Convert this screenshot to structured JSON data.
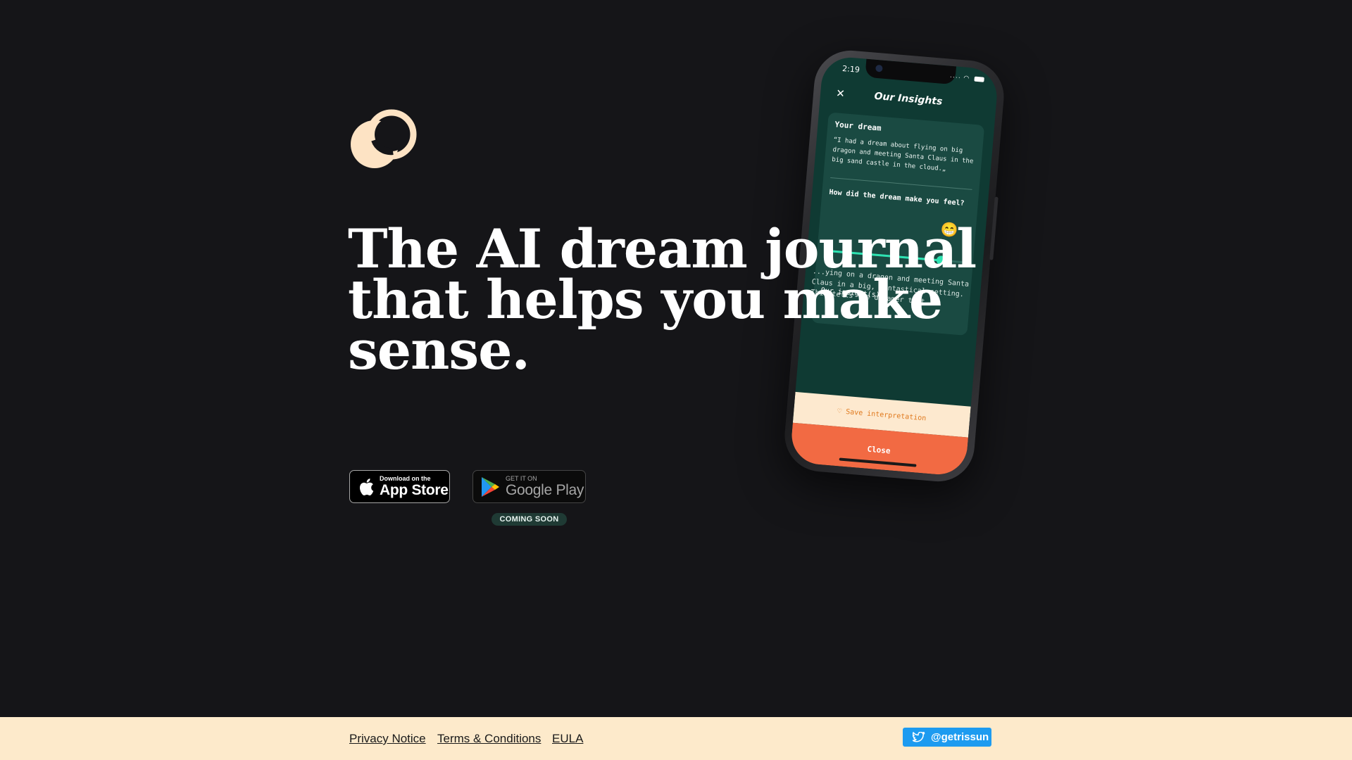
{
  "hero": {
    "headline": "The AI dream journal that helps you make sense."
  },
  "phone": {
    "status_time": "2:19",
    "close_symbol": "✕",
    "title": "Our Insights",
    "dream_label": "Your dream",
    "dream_text": "“I had a dream about flying on big dragon and meeting Santa Claus in the big sand castle in the cloud.„",
    "feel_question": "How did the dream make you feel?",
    "feel_emoji": "😁",
    "feel_level": 0.83,
    "insights_label": "Our insight(s)",
    "insight_text": "...ying on a dragon and meeting Santa Claus in a big, fantastical setting. This tells the dreamer that",
    "save_label": "Save interpretation",
    "close_label": "Close"
  },
  "badges": {
    "apple_small": "Download on the",
    "apple_big": "App Store",
    "google_small": "GET IT ON",
    "google_big": "Google Play",
    "coming_soon": "COMING SOON"
  },
  "footer": {
    "privacy": "Privacy Notice",
    "terms": "Terms & Conditions",
    "eula": "EULA",
    "twitter_handle": "@getrissun"
  },
  "colors": {
    "background": "#151518",
    "logo": "#fde3c4",
    "screen": "#0f3a33",
    "accent_green": "#2ee3b2",
    "save": "#fde9cf",
    "close": "#f26a43",
    "footer": "#fdeacb",
    "twitter": "#1d9bf0"
  },
  "icons": {
    "logo": "logo-rings-icon",
    "apple": "apple-icon",
    "google_play": "google-play-icon",
    "twitter": "twitter-icon",
    "heart": "heart-icon"
  }
}
